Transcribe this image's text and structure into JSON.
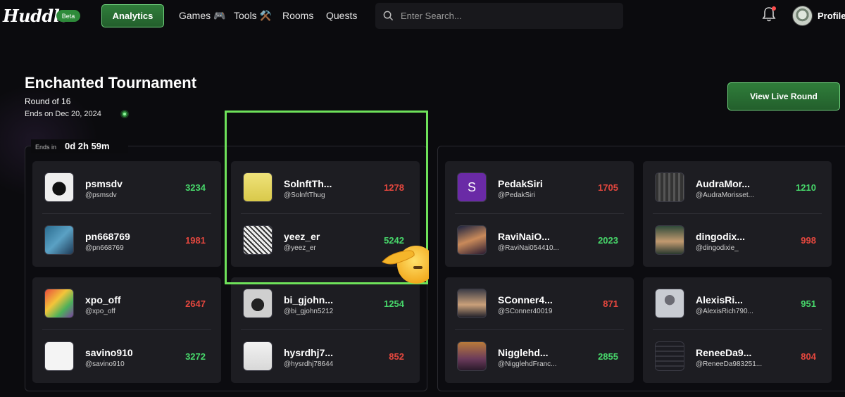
{
  "nav": {
    "logo": "Huddle",
    "beta": "Beta",
    "analytics": "Analytics",
    "games": "Games 🎮",
    "tools": "Tools ⚒️",
    "rooms": "Rooms",
    "quests": "Quests",
    "search_placeholder": "Enter Search...",
    "profile": "Profile"
  },
  "header": {
    "title": "Enchanted Tournament",
    "round": "Round of 16",
    "ends_on": "Ends on Dec 20, 2024",
    "live_button": "View Live Round"
  },
  "timer": {
    "label": "Ends in",
    "value": "0d 2h 59m"
  },
  "colors": {
    "accent": "#2f7d3a",
    "win": "#47d66a",
    "lose": "#e4473e",
    "highlight": "#6ee25a"
  },
  "matches": [
    {
      "players": [
        {
          "name": "psmsdv",
          "handle": "@psmsdv",
          "score": "3234",
          "result": "win",
          "avatar": "hooded-figure-avatar"
        },
        {
          "name": "pn668769",
          "handle": "@pn668769",
          "score": "1981",
          "result": "lose",
          "avatar": "blue-creature-avatar"
        }
      ]
    },
    {
      "players": [
        {
          "name": "SolnftTh...",
          "handle": "@SolnftThug",
          "score": "1278",
          "result": "lose",
          "avatar": "yellow-pixel-avatar"
        },
        {
          "name": "yeez_er",
          "handle": "@yeez_er",
          "score": "5242",
          "result": "win",
          "avatar": "sketch-face-avatar"
        }
      ]
    },
    {
      "players": [
        {
          "name": "xpo_off",
          "handle": "@xpo_off",
          "score": "2647",
          "result": "lose",
          "avatar": "colorful-toy-avatar"
        },
        {
          "name": "savino910",
          "handle": "@savino910",
          "score": "3272",
          "result": "win",
          "avatar": "logo-mark-avatar"
        }
      ]
    },
    {
      "players": [
        {
          "name": "bi_gjohn...",
          "handle": "@bi_gjohn5212",
          "score": "1254",
          "result": "win",
          "avatar": "gray-device-avatar"
        },
        {
          "name": "hysrdhj7...",
          "handle": "@hysrdhj78644",
          "score": "852",
          "result": "lose",
          "avatar": "pale-pixel-avatar"
        }
      ]
    },
    {
      "players": [
        {
          "name": "PedakSiri",
          "handle": "@PedakSiri",
          "score": "1705",
          "result": "lose",
          "avatar": "letter-s-avatar",
          "initial": "S"
        },
        {
          "name": "RaviNaiO...",
          "handle": "@RaviNai054410...",
          "score": "2023",
          "result": "win",
          "avatar": "portrait-avatar"
        }
      ]
    },
    {
      "players": [
        {
          "name": "AudraMor...",
          "handle": "@AudraMorisset...",
          "score": "1210",
          "result": "win",
          "avatar": "dark-pattern-avatar"
        },
        {
          "name": "dingodix...",
          "handle": "@dingodixie_",
          "score": "998",
          "result": "lose",
          "avatar": "figure-avatar"
        }
      ]
    },
    {
      "players": [
        {
          "name": "SConner4...",
          "handle": "@SConner40019",
          "score": "871",
          "result": "lose",
          "avatar": "speaker-avatar"
        },
        {
          "name": "Nigglehd...",
          "handle": "@NigglehdFranc...",
          "score": "2855",
          "result": "win",
          "avatar": "anime-avatar"
        }
      ]
    },
    {
      "players": [
        {
          "name": "AlexisRi...",
          "handle": "@AlexisRich790...",
          "score": "951",
          "result": "win",
          "avatar": "default-user-avatar"
        },
        {
          "name": "ReneeDa9...",
          "handle": "@ReneeDa983251...",
          "score": "804",
          "result": "lose",
          "avatar": "dark-grid-avatar"
        }
      ]
    }
  ]
}
